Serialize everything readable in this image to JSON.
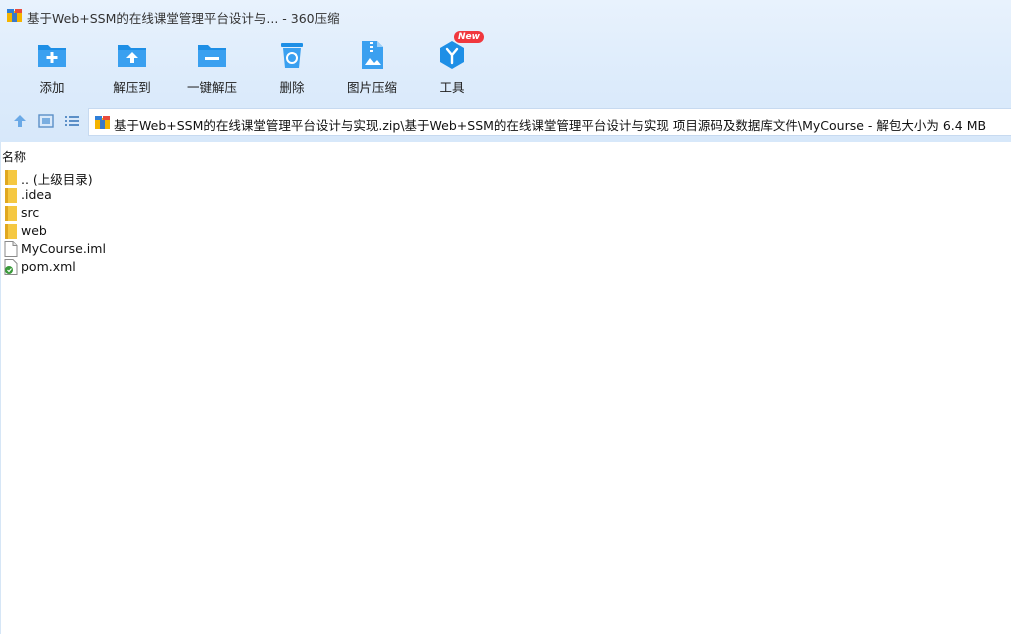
{
  "window": {
    "title": "基于Web+SSM的在线课堂管理平台设计与... - 360压缩",
    "app_icon": "archive-app-icon"
  },
  "toolbar": {
    "items": [
      {
        "label": "添加",
        "icon": "add-folder-icon"
      },
      {
        "label": "解压到",
        "icon": "extract-to-icon"
      },
      {
        "label": "一键解压",
        "icon": "one-click-extract-icon"
      },
      {
        "label": "删除",
        "icon": "recycle-bin-icon"
      },
      {
        "label": "图片压缩",
        "icon": "image-compress-icon"
      },
      {
        "label": "工具",
        "icon": "tools-icon",
        "badge": "New"
      }
    ]
  },
  "nav": {
    "up_icon": "up-arrow-icon",
    "view_thumb_icon": "thumbnail-view-icon",
    "view_list_icon": "list-view-icon",
    "address": "基于Web+SSM的在线课堂管理平台设计与实现.zip\\基于Web+SSM的在线课堂管理平台设计与实现 项目源码及数据库文件\\MyCourse - 解包大小为 6.4 MB"
  },
  "list": {
    "column_name": "名称",
    "rows": [
      {
        "name": ".. (上级目录)",
        "icon": "folder-icon"
      },
      {
        "name": ".idea",
        "icon": "folder-icon"
      },
      {
        "name": "src",
        "icon": "folder-icon"
      },
      {
        "name": "web",
        "icon": "folder-icon"
      },
      {
        "name": "MyCourse.iml",
        "icon": "file-icon"
      },
      {
        "name": "pom.xml",
        "icon": "xml-file-icon"
      }
    ]
  },
  "colors": {
    "accent": "#1e8fe6",
    "toolbar_bg": "#dcebfb",
    "badge": "#f0383e",
    "folder": "#f5c842"
  }
}
